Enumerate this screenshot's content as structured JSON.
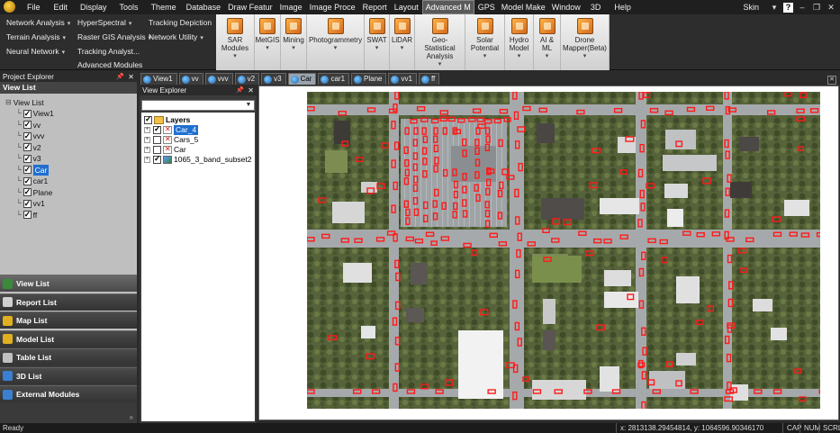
{
  "menubar": {
    "items": [
      "File",
      "Edit",
      "Display",
      "Tools",
      "Theme",
      "Database",
      "Draw Featur",
      "Image",
      "Image Proce",
      "Report",
      "Layout",
      "Advanced M",
      "GPS",
      "Model Make",
      "Window",
      "3D",
      "Help"
    ],
    "active_index": 11,
    "skin_label": "Skin"
  },
  "ribbon": {
    "left_items": [
      {
        "label": "Network Analysis",
        "dropdown": true
      },
      {
        "label": "HyperSpectral",
        "dropdown": true
      },
      {
        "label": "Tracking Depiction",
        "dropdown": false
      },
      {
        "label": "Terrain Analysis",
        "dropdown": true
      },
      {
        "label": "Raster GIS Analysis",
        "dropdown": true
      },
      {
        "label": "Network Utility",
        "dropdown": true
      },
      {
        "label": "Neural Network",
        "dropdown": true
      },
      {
        "label": "Tracking Analyst...",
        "dropdown": false
      },
      {
        "label": "Advanced Modules",
        "dropdown": false
      }
    ],
    "tools": [
      {
        "label": "SAR Modules",
        "width": 43
      },
      {
        "label": "MetGIS",
        "width": 29
      },
      {
        "label": "Mining",
        "width": 29
      },
      {
        "label": "Photogrammetry",
        "width": 64
      },
      {
        "label": "SWAT",
        "width": 28
      },
      {
        "label": "LiDAR",
        "width": 28
      },
      {
        "label": "Geo-Statistical Analysis",
        "width": 56
      },
      {
        "label": "Solar Potential",
        "width": 44
      },
      {
        "label": "Hydro Model",
        "width": 32
      },
      {
        "label": "AI & ML",
        "width": 30
      },
      {
        "label": "Drone Mapper(Beta)",
        "width": 54
      }
    ]
  },
  "project_explorer": {
    "title": "Project Explorer",
    "section": "View List",
    "root": "View List",
    "views": [
      "View1",
      "vv",
      "vvv",
      "v2",
      "v3",
      "Car",
      "car1",
      "Plane",
      "vv1",
      "ff"
    ],
    "selected": "Car",
    "lists": [
      {
        "label": "View List",
        "color": "#3a8a3a",
        "active": true
      },
      {
        "label": "Report List",
        "color": "#d0d0d0",
        "active": false
      },
      {
        "label": "Map List",
        "color": "#e0b020",
        "active": false
      },
      {
        "label": "Model List",
        "color": "#e0b020",
        "active": false
      },
      {
        "label": "Table List",
        "color": "#c0c0c0",
        "active": false
      },
      {
        "label": "3D List",
        "color": "#3a7fd0",
        "active": false
      },
      {
        "label": "External Modules",
        "color": "#3a7fd0",
        "active": false
      }
    ],
    "expander": "»"
  },
  "view_explorer": {
    "title": "View Explorer",
    "combo_value": "",
    "root": "Layers",
    "layers": [
      {
        "name": "Car_4",
        "checked": true,
        "selected": true,
        "kind": "vector"
      },
      {
        "name": "Cars_5",
        "checked": false,
        "selected": false,
        "kind": "vector"
      },
      {
        "name": "Car",
        "checked": false,
        "selected": false,
        "kind": "vector"
      },
      {
        "name": "1065_3_band_subset2",
        "checked": true,
        "selected": false,
        "kind": "raster"
      }
    ]
  },
  "doc_tabs": {
    "tabs": [
      "View1",
      "vv",
      "vvv",
      "v2",
      "v3",
      "Car",
      "car1",
      "Plane",
      "vv1",
      "ff"
    ],
    "active": "Car"
  },
  "status": {
    "ready": "Ready",
    "coords": "x: 2813138.29454814,   y: 1064596.90346170",
    "cap": "CAP",
    "num": "NUM",
    "scrl": "SCRL"
  }
}
